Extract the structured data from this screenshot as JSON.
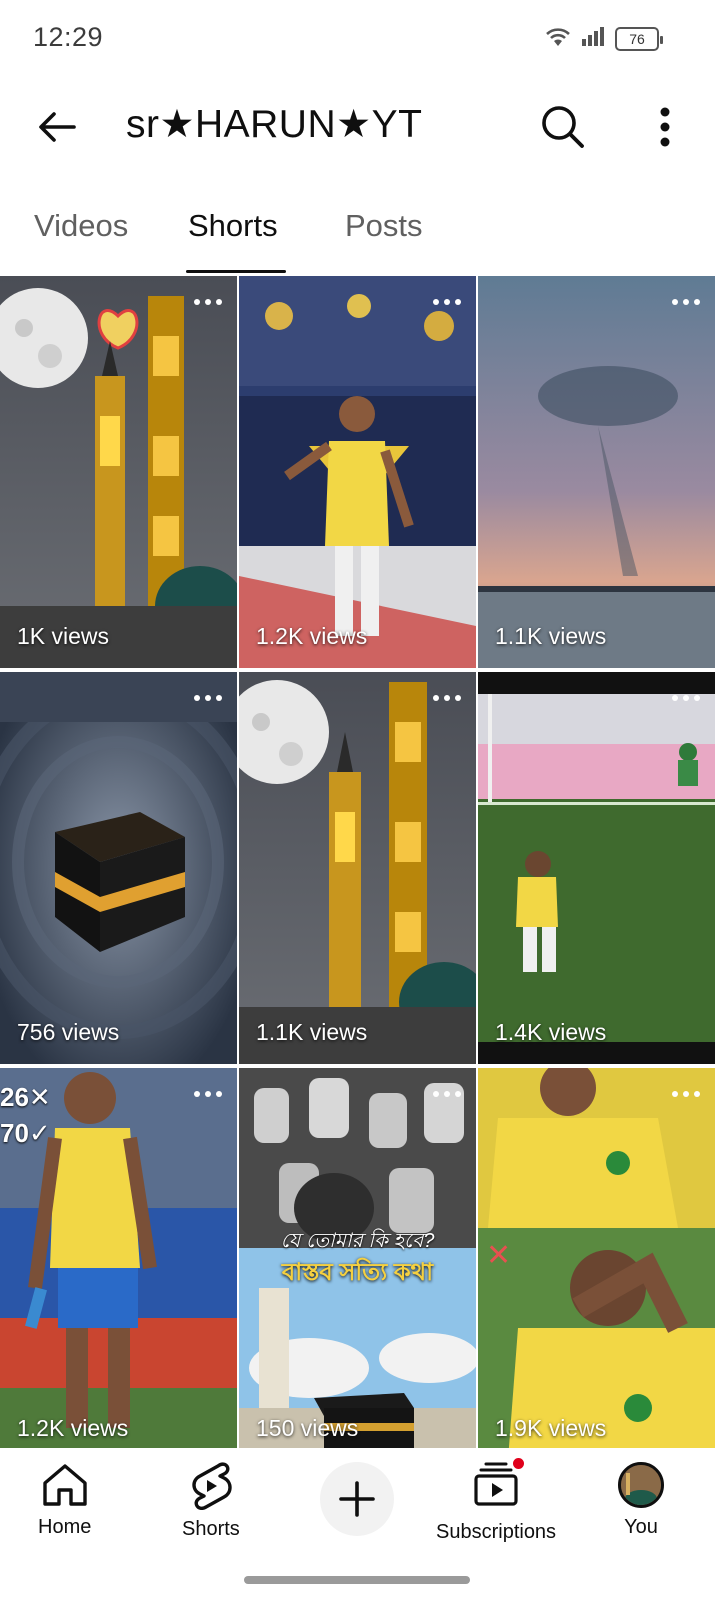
{
  "status_bar": {
    "time": "12:29",
    "battery": "76",
    "icons": [
      "wifi-icon",
      "signal-icon",
      "battery-icon"
    ]
  },
  "header": {
    "title": "sr★HARUN★YT",
    "back_icon": "arrow-left-icon",
    "search_icon": "search-icon",
    "more_icon": "more-vertical-icon"
  },
  "tabs": [
    {
      "label": "Videos",
      "active": false
    },
    {
      "label": "Shorts",
      "active": true
    },
    {
      "label": "Posts",
      "active": false
    }
  ],
  "shorts": [
    {
      "views": "1K views",
      "scene": "mosque-moon"
    },
    {
      "views": "1.2K views",
      "scene": "footballer-yellow"
    },
    {
      "views": "1.1K views",
      "scene": "sky-sea"
    },
    {
      "views": "756 views",
      "scene": "kaaba"
    },
    {
      "views": "1.1K views",
      "scene": "mosque-moon"
    },
    {
      "views": "1.4K views",
      "scene": "football-pitch"
    },
    {
      "views": "1.2K views",
      "scene": "footballer-walking",
      "overlay_text": [
        "26✕",
        "70✓"
      ]
    },
    {
      "views": "150 views",
      "scene": "graves-kaaba",
      "overlay_text": [
        "যে তোমার কি হবে?",
        "বাস্তব সত্যি কথা"
      ]
    },
    {
      "views": "1.9K views",
      "scene": "footballer-crying"
    }
  ],
  "bottom_nav": {
    "items": [
      {
        "label": "Home",
        "icon": "home-icon"
      },
      {
        "label": "Shorts",
        "icon": "shorts-icon"
      },
      {
        "label": "",
        "icon": "plus-icon"
      },
      {
        "label": "Subscriptions",
        "icon": "subscriptions-icon",
        "badge": true
      },
      {
        "label": "You",
        "icon": "avatar"
      }
    ]
  },
  "colors": {
    "text_primary": "#0f0f0f",
    "text_secondary": "#606060",
    "badge_red": "#e0001b",
    "background": "#ffffff"
  }
}
